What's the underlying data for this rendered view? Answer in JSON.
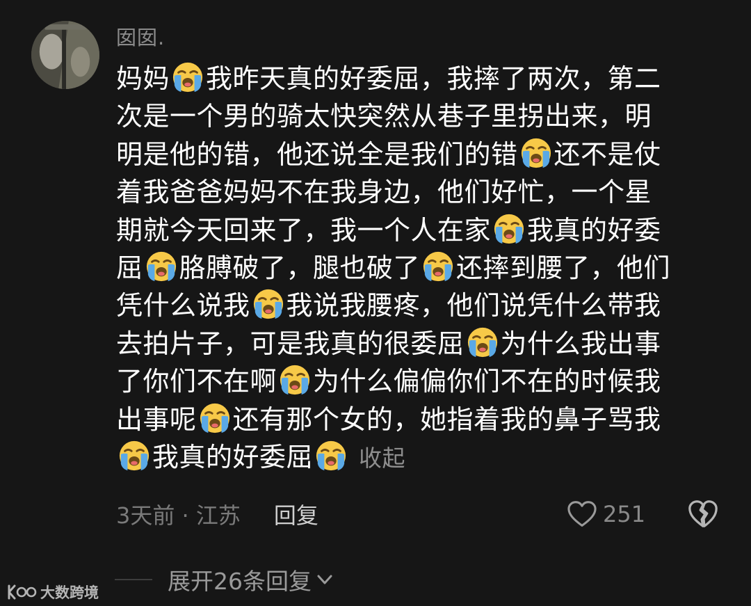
{
  "comment": {
    "username": "囡囡.",
    "lines": [
      [
        "妈妈",
        "@emoji",
        "我昨天真的好委屈，我摔了两次，第二"
      ],
      [
        "次是一个男的骑太快突然从巷子里拐出来，明"
      ],
      [
        "明是他的错，他还说全是我们的错",
        "@emoji",
        "还不是仗"
      ],
      [
        "着我爸爸妈妈不在我身边，他们好忙，一个星"
      ],
      [
        "期就今天回来了，我一个人在家",
        "@emoji",
        "我真的好委"
      ],
      [
        "屈",
        "@emoji",
        "胳膊破了，腿也破了",
        "@emoji",
        "还摔到腰了，他们"
      ],
      [
        "凭什么说我",
        "@emoji",
        "我说我腰疼，他们说凭什么带我"
      ],
      [
        "去拍片子，可是我真的很委屈",
        "@emoji",
        "为什么我出事"
      ],
      [
        "了你们不在啊",
        "@emoji",
        "为什么偏偏你们不在的时候我"
      ],
      [
        "出事呢",
        "@emoji",
        "还有那个女的，她指着我的鼻子骂我"
      ],
      [
        "@emoji",
        "我真的好委屈",
        "@emoji"
      ]
    ],
    "emoji_icon": "loudly-crying-face-icon",
    "collapse_label": "收起",
    "time_location": "3天前 · 江苏",
    "reply_label": "回复",
    "like_count": "251",
    "expand_label": "展开26条回复"
  },
  "watermark": {
    "text": "大数跨境"
  },
  "colors": {
    "background": "#161616",
    "text": "#ffffff",
    "muted": "#8a8a8a",
    "emoji_face": "#f7c948",
    "emoji_tears": "#5aa9e6"
  }
}
